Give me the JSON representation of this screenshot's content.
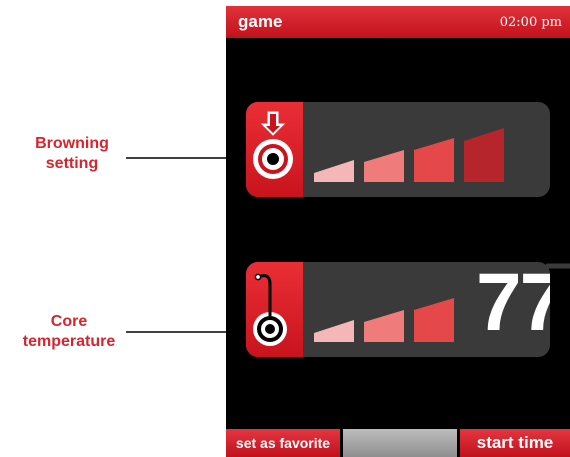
{
  "callouts": {
    "browning": [
      "Browning",
      "setting"
    ],
    "core": [
      "Core",
      "temperature"
    ]
  },
  "device": {
    "app_title": "game",
    "clock": "02:00 pm",
    "browning": {
      "icon": "target-arrow-icon",
      "levels": 4,
      "active_level": 4
    },
    "core": {
      "icon": "temperature-probe-icon",
      "levels": 3,
      "active_level": 3,
      "value": "77"
    },
    "buttons": {
      "favorite": "set as favorite",
      "start": "start time"
    }
  },
  "colors": {
    "accent": "#d6252f",
    "panel": "#3a3a3a",
    "bar_1": "#f4b6b6",
    "bar_2": "#ef7b7b",
    "bar_3": "#e44848",
    "bar_4": "#b5252b"
  }
}
